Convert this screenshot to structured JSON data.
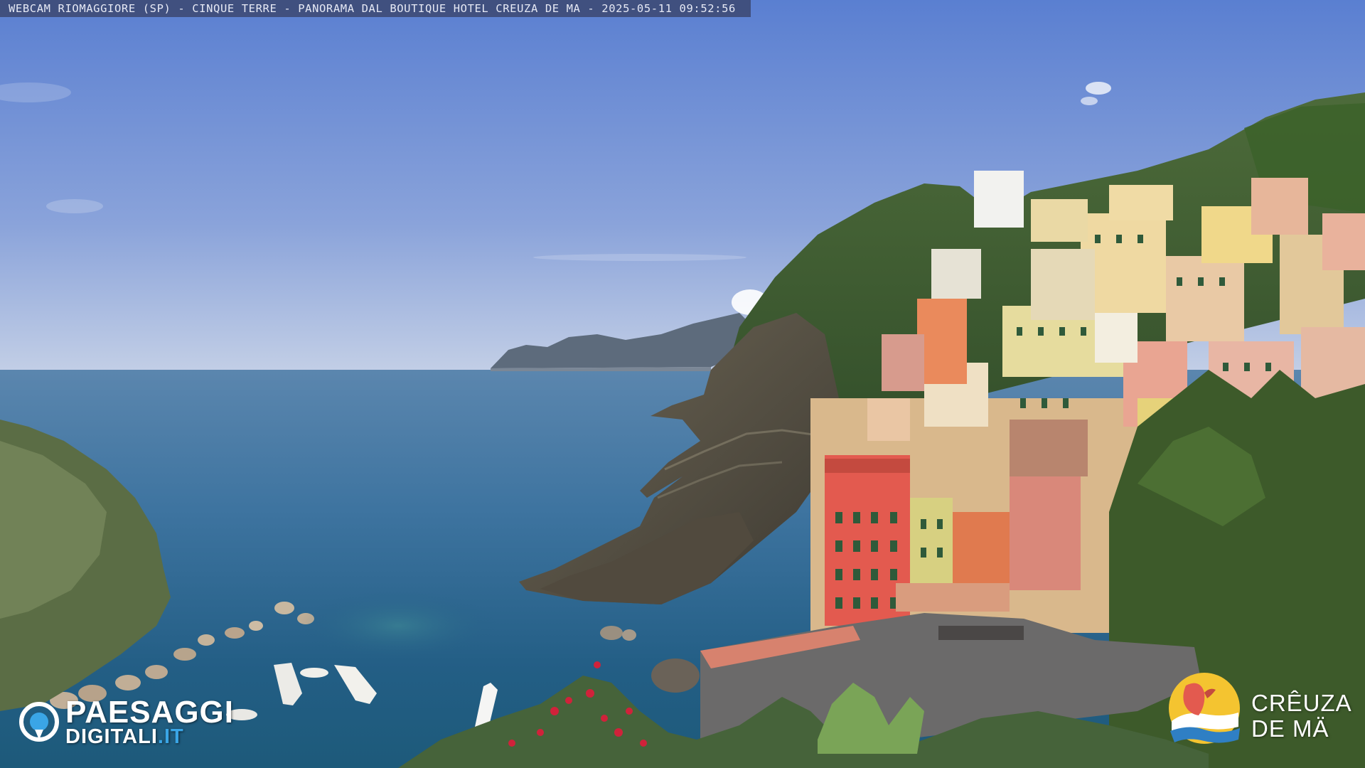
{
  "overlay": {
    "caption": "WEBCAM RIOMAGGIORE (SP) - CINQUE TERRE - PANORAMA DAL BOUTIQUE HOTEL CREUZA DE MA - 2025-05-11 09:52:56"
  },
  "brand_left": {
    "line1": "PAESAGGI",
    "line2_main": "DIGITALI",
    "line2_tld": ".IT",
    "icon": "location-pin-icon"
  },
  "brand_right": {
    "line1": "CRÊUZA",
    "line2": "DE MÄ",
    "icon": "bird-emblem-icon"
  },
  "colors": {
    "sky_top": "#5f83d2",
    "sky_horizon": "#b8c6e4",
    "sea_far": "#4f7fa9",
    "sea_near": "#1f5f86",
    "brand_blue": "#3aa5e6"
  }
}
